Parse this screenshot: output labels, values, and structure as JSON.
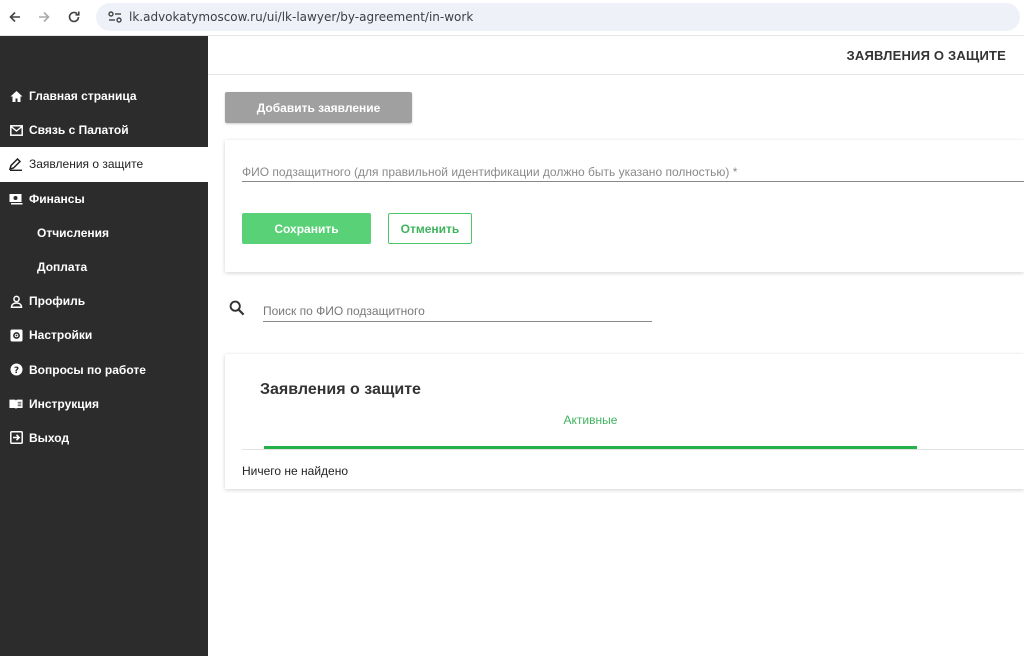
{
  "browser": {
    "url": "lk.advokatymoscow.ru/ui/lk-lawyer/by-agreement/in-work"
  },
  "header": {
    "title": "ЗАЯВЛЕНИЯ О ЗАЩИТЕ"
  },
  "sidebar": {
    "items": [
      {
        "label": "Главная страница",
        "icon": "home-icon"
      },
      {
        "label": "Связь с Палатой",
        "icon": "mail-icon"
      },
      {
        "label": "Заявления о защите",
        "icon": "pen-icon",
        "active": true
      },
      {
        "label": "Финансы",
        "icon": "money-icon"
      },
      {
        "label": "Отчисления",
        "sub": true
      },
      {
        "label": "Доплата",
        "sub": true
      },
      {
        "label": "Профиль",
        "icon": "user-icon"
      },
      {
        "label": "Настройки",
        "icon": "settings-icon"
      },
      {
        "label": "Вопросы по работе",
        "icon": "help-icon"
      },
      {
        "label": "Инструкция",
        "icon": "book-icon"
      },
      {
        "label": "Выход",
        "icon": "logout-icon"
      }
    ]
  },
  "toolbar": {
    "add_label": "Добавить заявление"
  },
  "form": {
    "fio_placeholder": "ФИО подзащитного (для правильной идентификации должно быть указано полностью) *",
    "fio_value": "",
    "save_label": "Сохранить",
    "cancel_label": "Отменить"
  },
  "search": {
    "placeholder": "Поиск по ФИО подзащитного",
    "value": ""
  },
  "list": {
    "title": "Заявления о защите",
    "tab_active": "Активные",
    "empty_text": "Ничего не найдено"
  },
  "colors": {
    "sidebar_bg": "#2c2c2c",
    "accent_green": "#25b14a",
    "save_green": "#58d177",
    "add_gray": "#a0a0a0"
  }
}
